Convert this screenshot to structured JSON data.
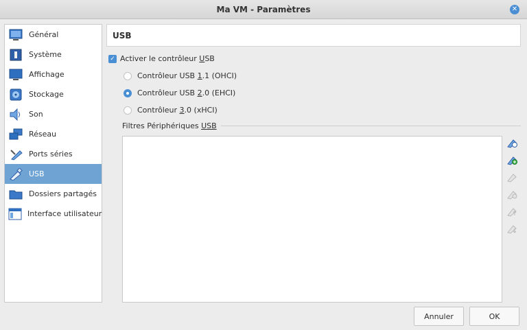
{
  "window": {
    "title": "Ma VM - Paramètres"
  },
  "sidebar": {
    "items": [
      {
        "label": "Général",
        "icon": "general-icon"
      },
      {
        "label": "Système",
        "icon": "system-chip-icon"
      },
      {
        "label": "Affichage",
        "icon": "display-monitor-icon"
      },
      {
        "label": "Stockage",
        "icon": "storage-disk-icon"
      },
      {
        "label": "Son",
        "icon": "speaker-icon"
      },
      {
        "label": "Réseau",
        "icon": "network-icon"
      },
      {
        "label": "Ports séries",
        "icon": "serial-port-icon"
      },
      {
        "label": "USB",
        "icon": "usb-icon",
        "selected": true
      },
      {
        "label": "Dossiers partagés",
        "icon": "shared-folder-icon"
      },
      {
        "label": "Interface utilisateur",
        "icon": "user-interface-icon"
      }
    ]
  },
  "main": {
    "title": "USB",
    "enable_usb": {
      "pre": "Activer le contrôleur ",
      "accel": "U",
      "post": "SB",
      "checked": true
    },
    "controllers": [
      {
        "pre": "Contrôleur USB ",
        "accel": "1",
        "post": ".1 (OHCI)",
        "checked": false
      },
      {
        "pre": "Contrôleur USB ",
        "accel": "2",
        "post": ".0 (EHCI)",
        "checked": true
      },
      {
        "pre": "Contrôleur ",
        "accel": "3",
        "post": ".0 (xHCI)",
        "checked": false
      }
    ],
    "filters": {
      "pre": "Filtres Périphériques ",
      "accel": "USB",
      "post": ""
    },
    "tools": [
      {
        "icon": "add-empty-filter-icon",
        "enabled": true
      },
      {
        "icon": "add-filter-from-device-icon",
        "enabled": true
      },
      {
        "icon": "edit-filter-icon",
        "enabled": false
      },
      {
        "icon": "remove-filter-icon",
        "enabled": false
      },
      {
        "icon": "move-filter-up-icon",
        "enabled": false
      },
      {
        "icon": "move-filter-down-icon",
        "enabled": false
      }
    ]
  },
  "buttons": {
    "cancel": "Annuler",
    "ok": "OK"
  },
  "colors": {
    "accent": "#4a8fd4",
    "selection": "#6fa3d4"
  }
}
